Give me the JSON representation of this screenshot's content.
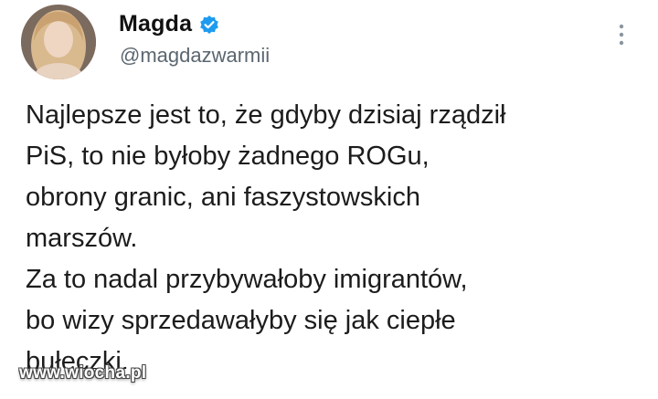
{
  "colors": {
    "verified": "#1d9bf0",
    "handle": "#5b6670"
  },
  "author": {
    "display_name": "Magda",
    "handle": "@magdazwarmii",
    "verified": true
  },
  "tweet": {
    "lines": [
      "Najlepsze jest to, że gdyby dzisiaj rządził",
      "PiS, to nie byłoby żadnego ROGu,",
      "obrony granic, ani faszystowskich",
      "marszów.",
      "Za to nadal przybywałoby imigrantów,",
      "bo wizy sprzedawałyby się jak ciepłe",
      "bułeczki."
    ]
  },
  "icons": {
    "verified": "verified-badge-icon",
    "more": "more-options-icon"
  },
  "watermark": {
    "text": "www.wiocha.pl"
  }
}
